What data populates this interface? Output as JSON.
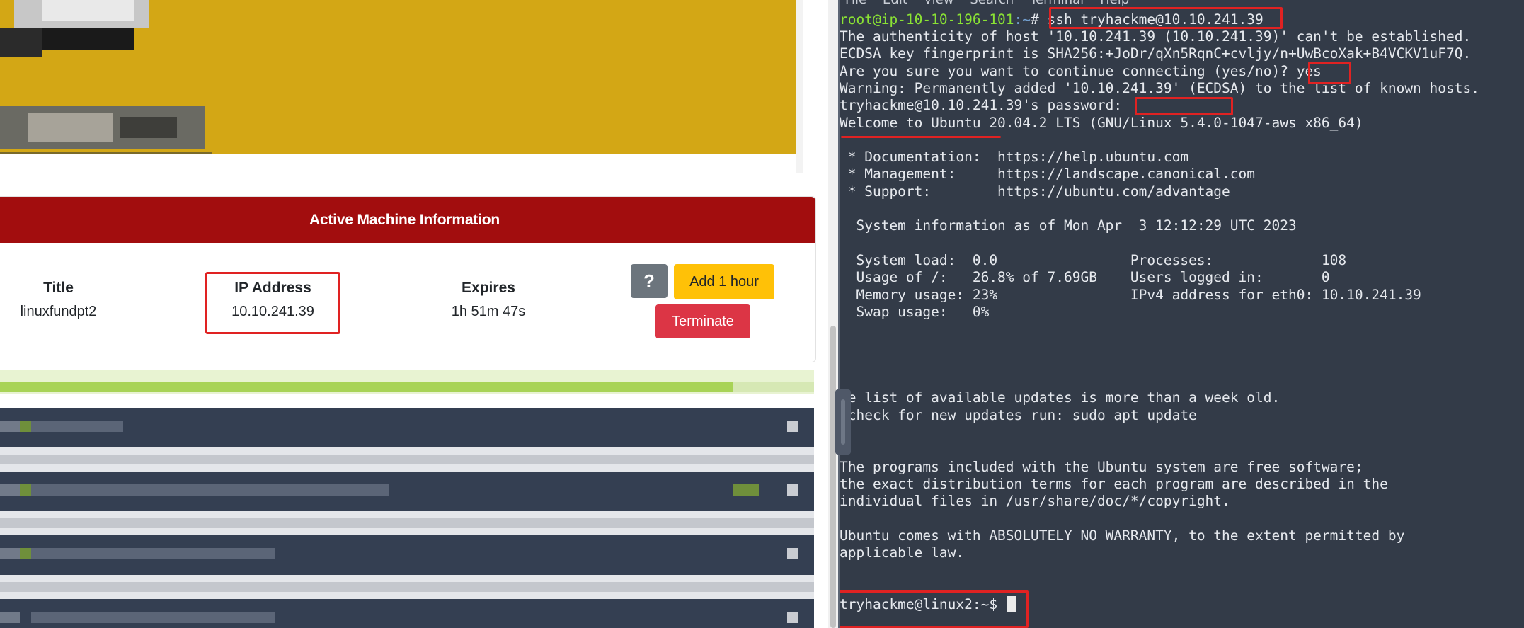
{
  "room_page": {
    "card_title": "Active Machine Information",
    "columns": [
      {
        "label": "Title",
        "value": "linuxfundpt2"
      },
      {
        "label": "IP Address",
        "value": "10.10.241.39"
      },
      {
        "label": "Expires",
        "value": "1h 51m 47s"
      }
    ],
    "buttons": {
      "help": "?",
      "add_hour": "Add 1 hour",
      "terminate": "Terminate"
    },
    "colors": {
      "header_red": "#a20d0e",
      "add_hour_yellow": "#ffc107",
      "terminate_red": "#dc3545",
      "help_gray": "#6c757d",
      "highlight_red": "#e02222"
    }
  },
  "terminal": {
    "menu": [
      "File",
      "Edit",
      "View",
      "Search",
      "Terminal",
      "Help"
    ],
    "initial_prompt": {
      "user_host": "root@ip-10-10-196-101",
      "path": ":~",
      "symbol": "#",
      "command": "ssh tryhackme@10.10.241.39"
    },
    "lines": [
      "The authenticity of host '10.10.241.39 (10.10.241.39)' can't be established.",
      "ECDSA key fingerprint is SHA256:+JoDr/qXn5RqnC+cvljy/n+UwBcoXak+B4VCKV1uF7Q.",
      "Are you sure you want to continue connecting (yes/no)? yes",
      "Warning: Permanently added '10.10.241.39' (ECDSA) to the list of known hosts.",
      "tryhackme@10.10.241.39's password: ",
      "Welcome to Ubuntu 20.04.2 LTS (GNU/Linux 5.4.0-1047-aws x86_64)",
      "",
      " * Documentation:  https://help.ubuntu.com",
      " * Management:     https://landscape.canonical.com",
      " * Support:        https://ubuntu.com/advantage",
      "",
      "  System information as of Mon Apr  3 12:12:29 UTC 2023",
      "",
      "  System load:  0.0                Processes:             108",
      "  Usage of /:   26.8% of 7.69GB    Users logged in:       0",
      "  Memory usage: 23%                IPv4 address for eth0: 10.10.241.39",
      "  Swap usage:   0%",
      "",
      "",
      "",
      "",
      "he list of available updates is more than a week old.",
      " check for new updates run: sudo apt update",
      "",
      "",
      "The programs included with the Ubuntu system are free software;",
      "the exact distribution terms for each program are described in the",
      "individual files in /usr/share/doc/*/copyright.",
      "",
      "Ubuntu comes with ABSOLUTELY NO WARRANTY, to the extent permitted by",
      "applicable law.",
      ""
    ],
    "final_prompt": "tryhackme@linux2:~$ "
  }
}
